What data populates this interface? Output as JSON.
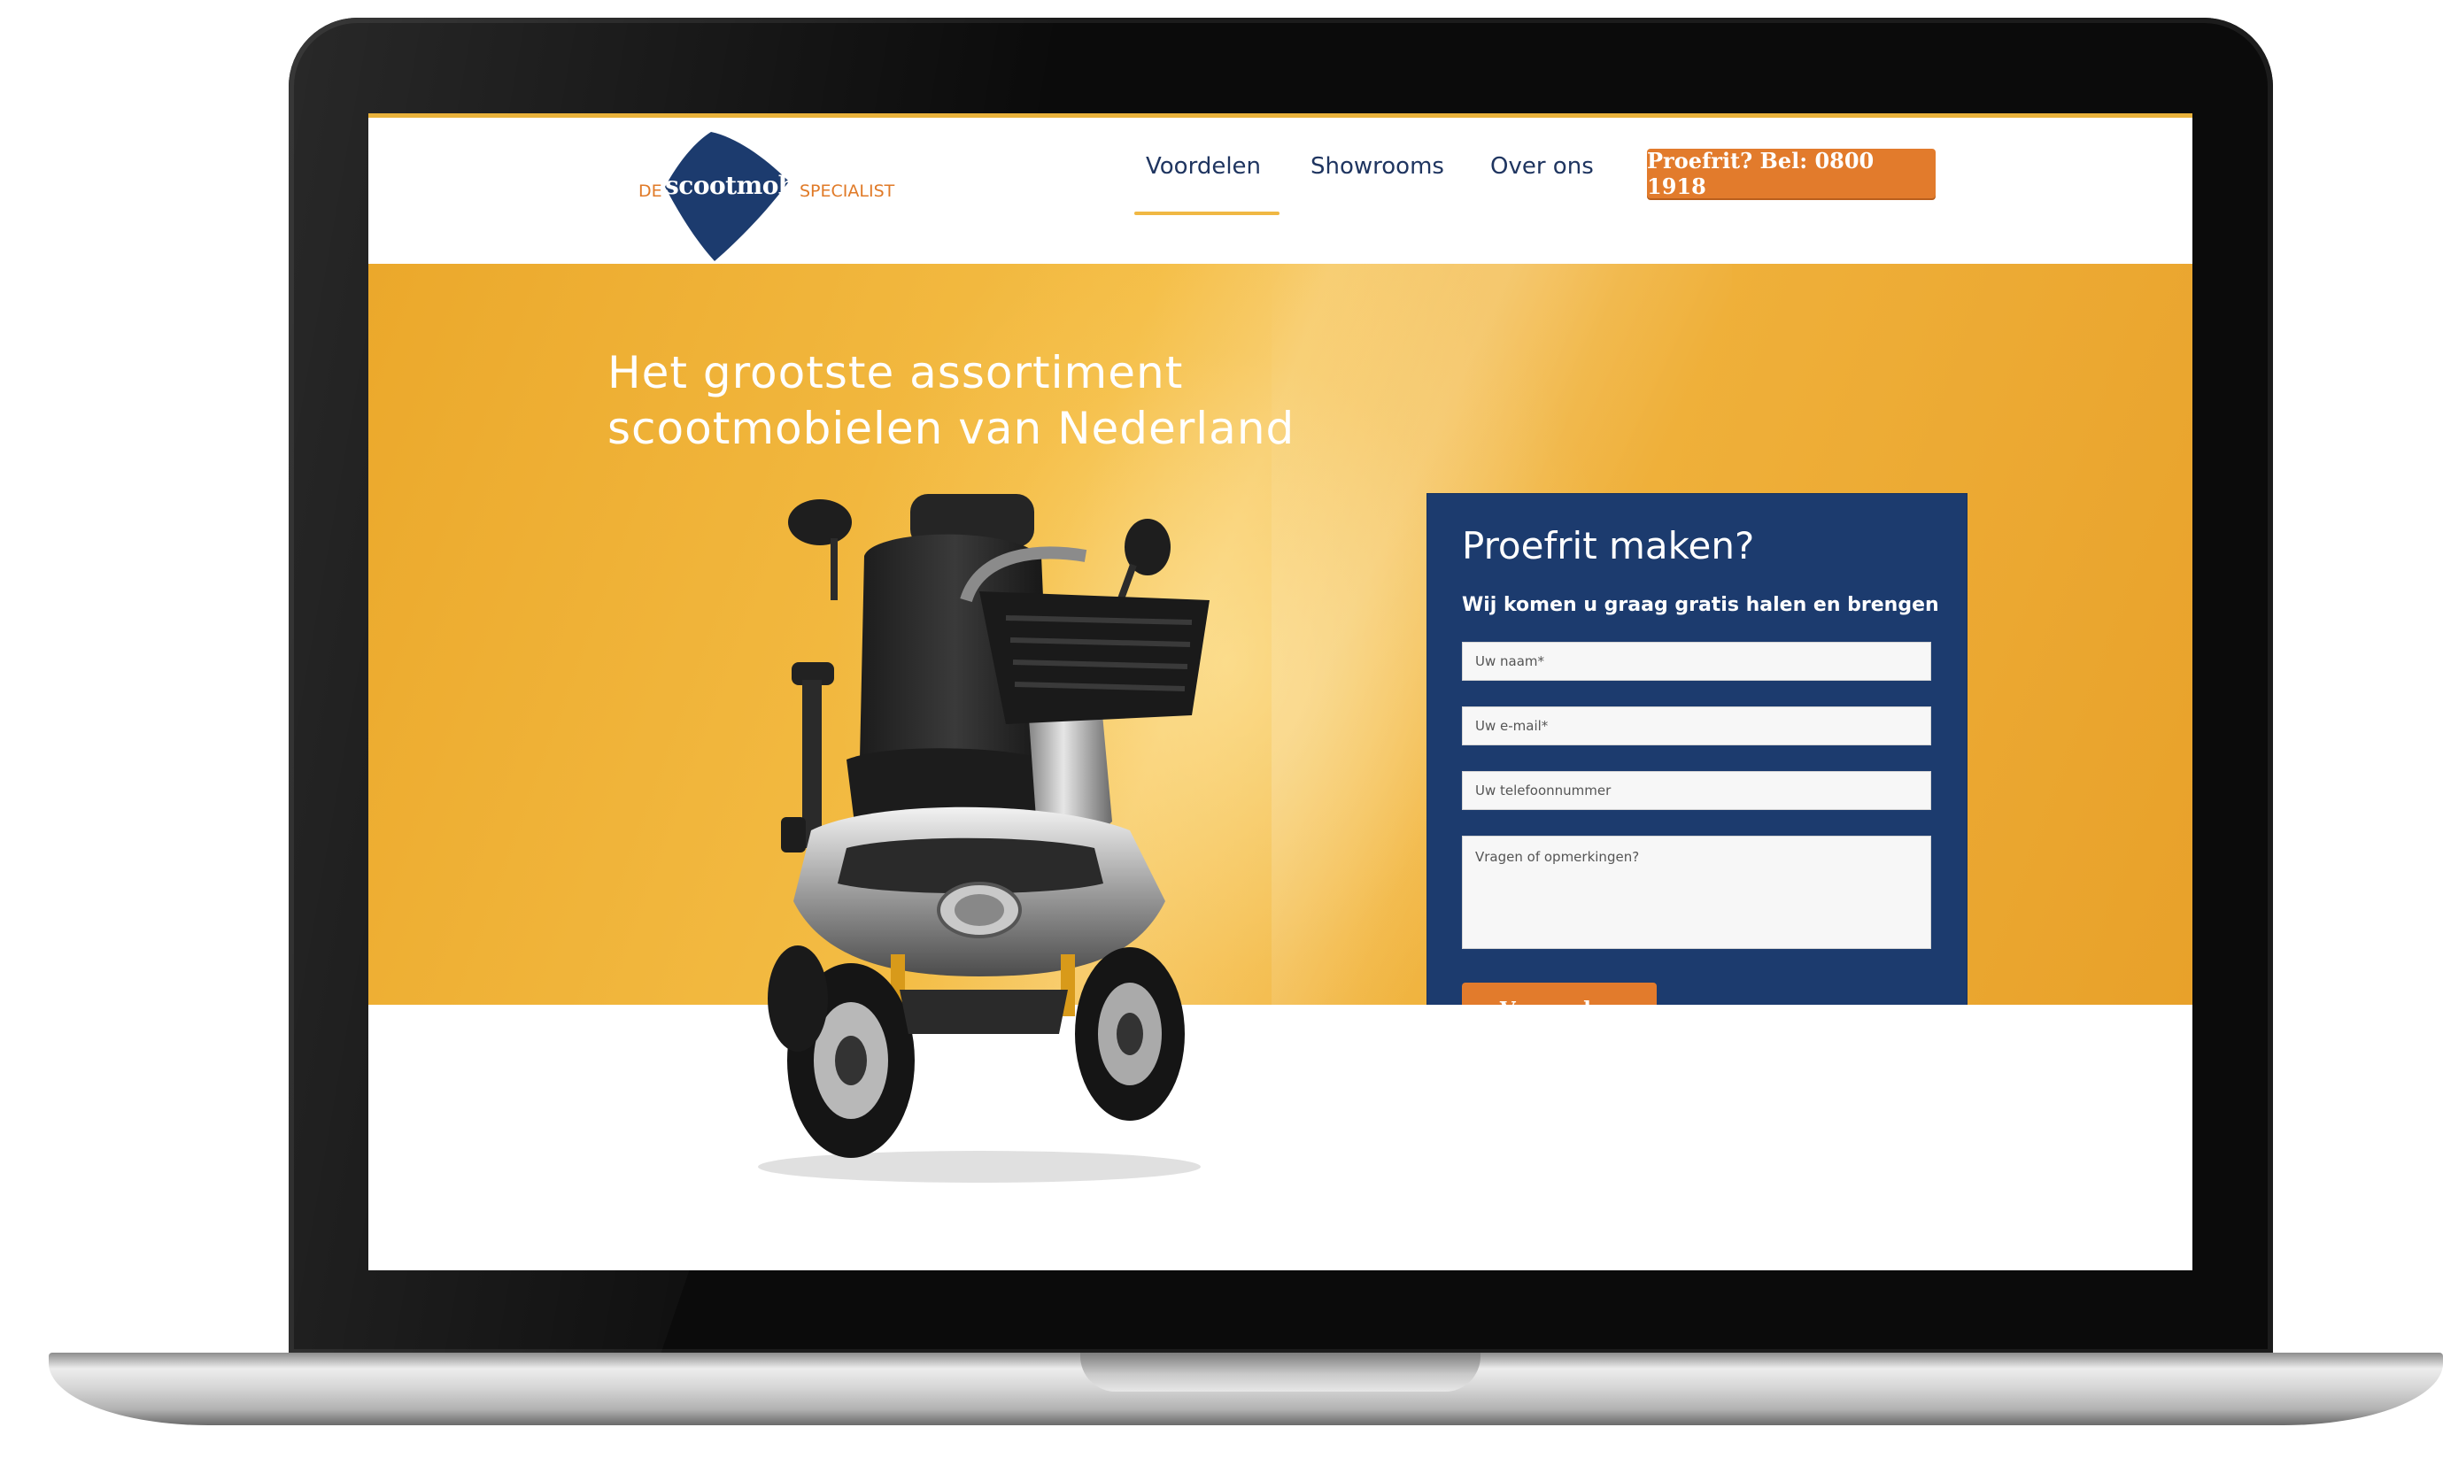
{
  "brand": {
    "logo_prefix": "DE",
    "logo_main": "scootmobiel",
    "logo_suffix": "SPECIALIST",
    "colors": {
      "navy": "#1c3b6e",
      "orange": "#e27b2c",
      "yellow": "#f2b33d"
    }
  },
  "nav": {
    "items": [
      {
        "label": "Voordelen",
        "active": true
      },
      {
        "label": "Showrooms",
        "active": false
      },
      {
        "label": "Over ons",
        "active": false
      }
    ],
    "cta_label": "Proefrit? Bel: 0800 1918"
  },
  "hero": {
    "headline_line1": "Het grootste assortiment",
    "headline_line2": "scootmobielen van Nederland"
  },
  "form": {
    "title": "Proefrit maken?",
    "subtitle": "Wij komen u graag gratis halen en brengen",
    "name_placeholder": "Uw naam*",
    "email_placeholder": "Uw e-mail*",
    "phone_placeholder": "Uw telefoonnummer",
    "comments_placeholder": "Vragen of opmerkingen?",
    "submit_label": "Verzenden"
  },
  "images": {
    "product": "mobility-scooter-photo"
  }
}
